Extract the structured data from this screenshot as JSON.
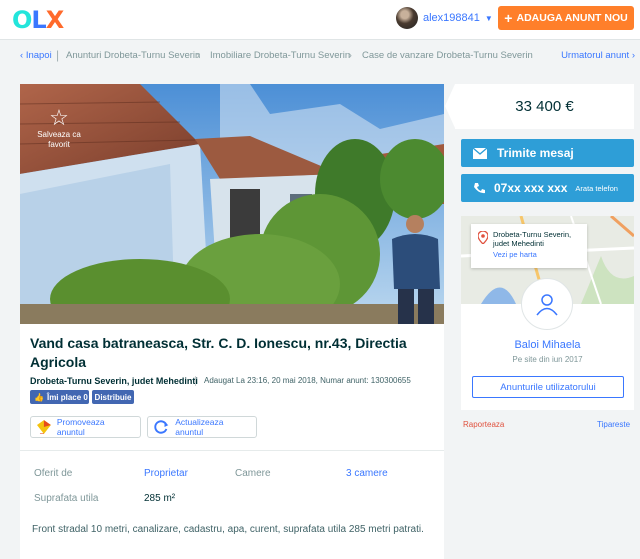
{
  "header": {
    "logo": "OLX",
    "username": "alex198841",
    "add_button_label": "ADAUGA ANUNT NOU"
  },
  "breadcrumb": {
    "back_label": "Inapoi",
    "items": [
      "Anunturi Drobeta-Turnu Severin",
      "Imobiliare Drobeta-Turnu Severin",
      "Case de vanzare Drobeta-Turnu Severin"
    ],
    "next_label": "Urmatorul anunt"
  },
  "listing": {
    "save_favorite_label": "Salveaza ca favorit",
    "title": "Vand casa batraneasca, Str. C. D. Ionescu, nr.43, Directia Agricola",
    "location": "Drobeta-Turnu Severin, judet Mehedinti",
    "meta": "Adaugat La 23:16, 20 mai 2018, Numar anunt: 130300655",
    "like_label": "Îmi place 0",
    "share_label": "Distribuie",
    "promote_label": "Promoveaza anuntul",
    "refresh_label": "Actualizeaza anuntul",
    "params": {
      "offered_by_label": "Oferit de",
      "offered_by_value": "Proprietar",
      "rooms_label": "Camere",
      "rooms_value": "3 camere",
      "area_label": "Suprafata utila",
      "area_value": "285 m²"
    },
    "description": "Front stradal 10 metri, canalizare, cadastru, apa, curent, suprafata utila 285 metri patrati."
  },
  "sidebar": {
    "price": "33 400 €",
    "message_button": "Trimite mesaj",
    "phone_number": "07xx xxx xxx",
    "phone_reveal": "Arata telefon",
    "map_location": "Drobeta-Turnu Severin, judet Mehedinti",
    "map_link": "Vezi pe harta",
    "seller_name": "Baloi Mihaela",
    "seller_since": "Pe site din iun 2017",
    "seller_ads_button": "Anunturile utilizatorului",
    "report_label": "Raporteaza",
    "print_label": "Tipareste"
  },
  "colors": {
    "accent_blue": "#3a77ff",
    "button_blue": "#2e9ed7",
    "orange": "#ff7f2a",
    "report_red": "#e0523f"
  }
}
